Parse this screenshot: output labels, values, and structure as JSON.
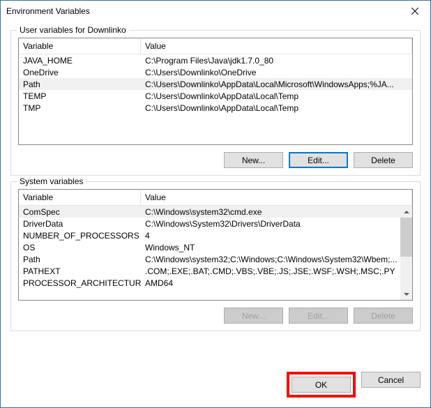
{
  "window": {
    "title": "Environment Variables"
  },
  "user_group": {
    "legend": "User variables for Downlinko",
    "headers": {
      "variable": "Variable",
      "value": "Value"
    },
    "rows": [
      {
        "variable": "JAVA_HOME",
        "value": "C:\\Program Files\\Java\\jdk1.7.0_80"
      },
      {
        "variable": "OneDrive",
        "value": "C:\\Users\\Downlinko\\OneDrive"
      },
      {
        "variable": "Path",
        "value": "C:\\Users\\Downlinko\\AppData\\Local\\Microsoft\\WindowsApps;%JA..."
      },
      {
        "variable": "TEMP",
        "value": "C:\\Users\\Downlinko\\AppData\\Local\\Temp"
      },
      {
        "variable": "TMP",
        "value": "C:\\Users\\Downlinko\\AppData\\Local\\Temp"
      }
    ],
    "selected_index": 2,
    "buttons": {
      "new": "New...",
      "edit": "Edit...",
      "delete": "Delete"
    }
  },
  "system_group": {
    "legend": "System variables",
    "headers": {
      "variable": "Variable",
      "value": "Value"
    },
    "rows": [
      {
        "variable": "ComSpec",
        "value": "C:\\Windows\\system32\\cmd.exe"
      },
      {
        "variable": "DriverData",
        "value": "C:\\Windows\\System32\\Drivers\\DriverData"
      },
      {
        "variable": "NUMBER_OF_PROCESSORS",
        "value": "4"
      },
      {
        "variable": "OS",
        "value": "Windows_NT"
      },
      {
        "variable": "Path",
        "value": "C:\\Windows\\system32;C:\\Windows;C:\\Windows\\System32\\Wbem;..."
      },
      {
        "variable": "PATHEXT",
        "value": ".COM;.EXE;.BAT;.CMD;.VBS;.VBE;.JS;.JSE;.WSF;.WSH;.MSC;.PY"
      },
      {
        "variable": "PROCESSOR_ARCHITECTURE",
        "value": "AMD64"
      }
    ],
    "selected_index": 0,
    "buttons": {
      "new": "New...",
      "edit": "Edit...",
      "delete": "Delete"
    }
  },
  "footer": {
    "ok": "OK",
    "cancel": "Cancel"
  }
}
